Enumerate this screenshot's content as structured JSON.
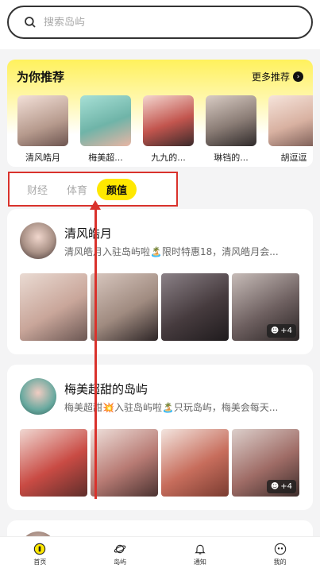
{
  "search": {
    "placeholder": "搜索岛屿"
  },
  "recommend": {
    "title": "为你推荐",
    "more": "更多推荐",
    "items": [
      {
        "name": "清风皓月",
        "color": "#b69a8d"
      },
      {
        "name": "梅美超...",
        "color": "#6fb4a8"
      },
      {
        "name": "九九的...",
        "color": "#c2554e"
      },
      {
        "name": "琳铛的...",
        "color": "#8a7c75"
      },
      {
        "name": "胡逗逗",
        "color": "#d8b1a1"
      }
    ]
  },
  "tabs": [
    "财经",
    "体育",
    "颜值"
  ],
  "active_tab_index": 2,
  "posts": [
    {
      "name": "清风皓月",
      "text": "清风皓月入驻岛屿啦🏝️限时特惠18，清风皓月会...",
      "more_count": "+4",
      "image_colors": [
        "#c9a69a",
        "#a08b80",
        "#463b3e",
        "#6e6060"
      ],
      "avatar_color": "#a99186"
    },
    {
      "name": "梅美超甜的岛屿",
      "text": "梅美超甜💥入驻岛屿啦🏝️只玩岛屿，梅美会每天...",
      "more_count": "+4",
      "image_colors": [
        "#c94b44",
        "#b87b74",
        "#c76d5c",
        "#9f6c66"
      ],
      "avatar_color": "#68a99f"
    }
  ],
  "tabbar": [
    {
      "label": "首页",
      "icon": "home-icon"
    },
    {
      "label": "岛屿",
      "icon": "planet-icon"
    },
    {
      "label": "通知",
      "icon": "bell-icon"
    },
    {
      "label": "我的",
      "icon": "profile-icon"
    }
  ],
  "colors": {
    "accent": "#ffe800",
    "annotation": "#d9322c"
  }
}
